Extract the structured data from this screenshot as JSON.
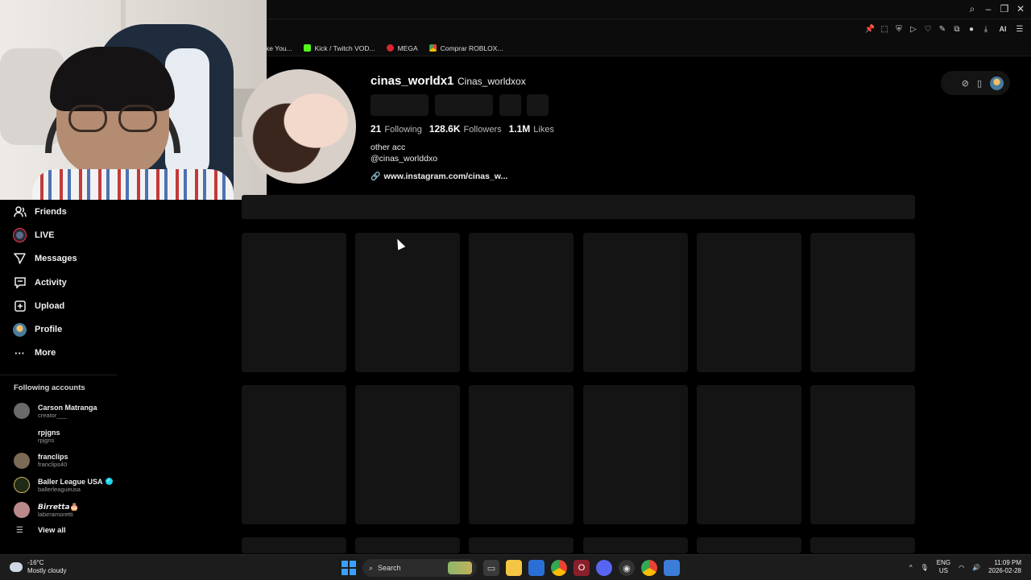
{
  "browser": {
    "bookmarks": [
      {
        "label": "ke You...",
        "color": "#e53935"
      },
      {
        "label": "Kick / Twitch VOD...",
        "color": "#53fc18"
      },
      {
        "label": "MEGA",
        "color": "#d9272e"
      },
      {
        "label": "Comprar ROBLOX...",
        "color": "#f5a623"
      }
    ],
    "ai_label": "AI"
  },
  "sidebar": {
    "nav": [
      {
        "label": "Friends",
        "icon": "friends-icon"
      },
      {
        "label": "LIVE",
        "icon": "live-icon"
      },
      {
        "label": "Messages",
        "icon": "messages-icon"
      },
      {
        "label": "Activity",
        "icon": "activity-icon"
      },
      {
        "label": "Upload",
        "icon": "upload-icon"
      },
      {
        "label": "Profile",
        "icon": "profile-avatar"
      },
      {
        "label": "More",
        "icon": "more-icon"
      }
    ],
    "following_title": "Following accounts",
    "accounts": [
      {
        "name": "Carson Matranga",
        "handle": "creator___",
        "verified": false,
        "avatar_color": "#6a6a6a"
      },
      {
        "name": "rpjgns",
        "handle": "rpjgns",
        "verified": false,
        "avatar_color": "#000000"
      },
      {
        "name": "franclips",
        "handle": "franclips40",
        "verified": false,
        "avatar_color": "#7b6a55"
      },
      {
        "name": "Baller League USA",
        "handle": "ballerleagueusa",
        "verified": true,
        "avatar_color": "#1f2a16"
      },
      {
        "name": "𝘽𝙞𝙧𝙧𝙚𝙩𝙩𝙖🎂",
        "handle": "labirramoretti",
        "verified": false,
        "avatar_color": "#b98a8a"
      }
    ],
    "view_all": "View all"
  },
  "profile": {
    "username": "cinas_worldx1",
    "nickname": "Cinas_worldxox",
    "following_count": "21",
    "following_label": "Following",
    "followers_count": "128.6K",
    "followers_label": "Followers",
    "likes_count": "1.1M",
    "likes_label": "Likes",
    "bio_line1": "other acc",
    "bio_line2": "@cinas_worlddxo",
    "link": "www.instagram.com/cinas_w..."
  },
  "taskbar": {
    "temperature": "-16°C",
    "weather": "Mostly cloudy",
    "search_placeholder": "Search",
    "lang1": "ENG",
    "lang2": "US",
    "time": "11:09 PM",
    "date": "2026-02-28"
  }
}
